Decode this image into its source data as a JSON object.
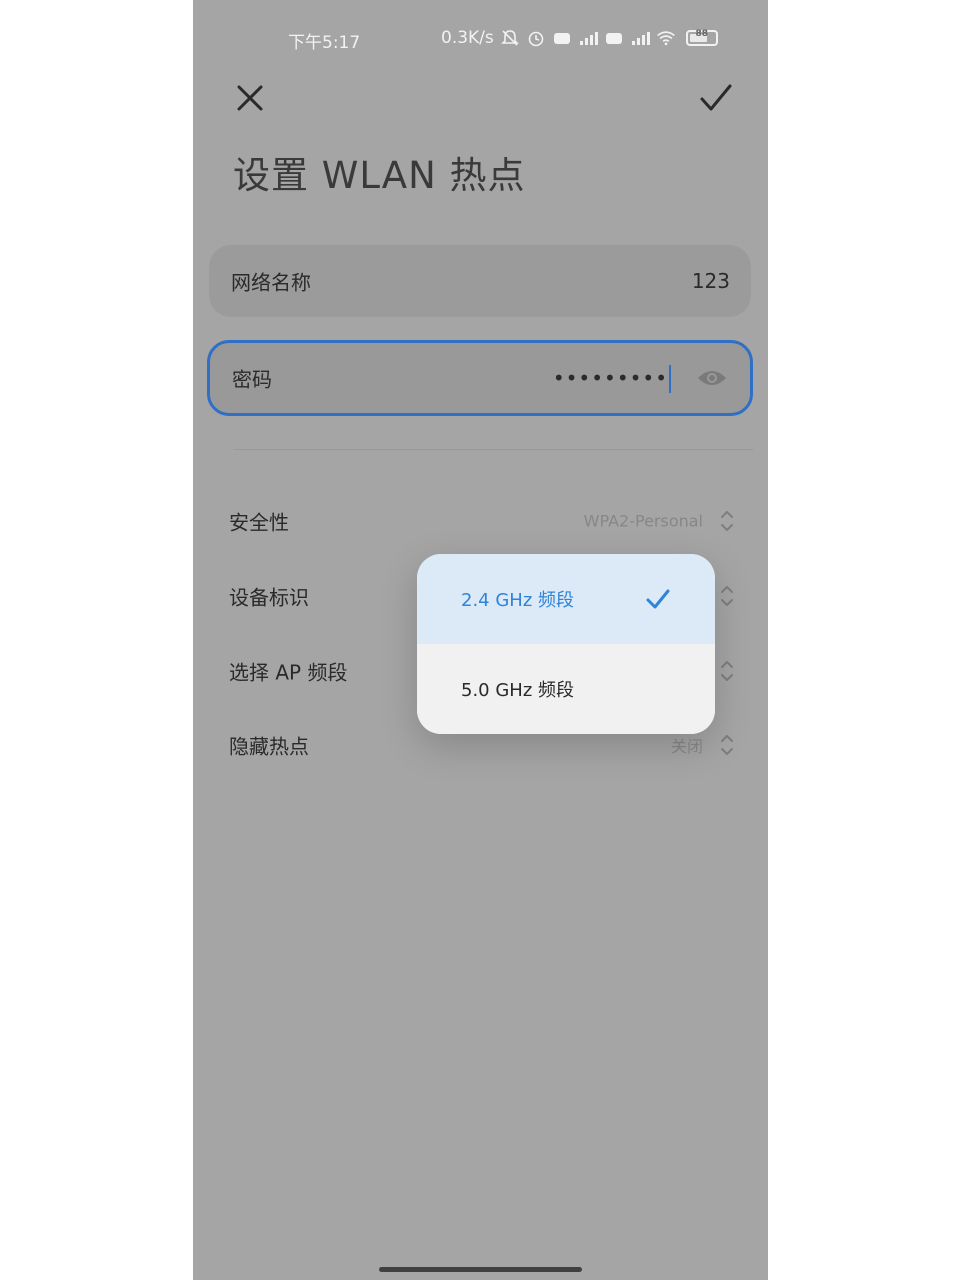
{
  "status_bar": {
    "time": "下午5:17",
    "net_speed": "0.3K/s",
    "battery_level": "88"
  },
  "header": {
    "title": "设置 WLAN 热点"
  },
  "form": {
    "ssid_label": "网络名称",
    "ssid_value": "123",
    "password_label": "密码",
    "password_masked": "•••••••••"
  },
  "settings": {
    "security_label": "安全性",
    "security_value": "WPA2-Personal",
    "device_id_label": "设备标识",
    "ap_band_label": "选择 AP 频段",
    "hidden_label": "隐藏热点",
    "hidden_value": "关闭"
  },
  "band_dropdown": {
    "options": [
      {
        "label": "2.4 GHz 频段",
        "selected": true
      },
      {
        "label": "5.0 GHz 频段",
        "selected": false
      }
    ]
  },
  "colors": {
    "accent": "#2f84d8",
    "focus_border": "#2f6fc6",
    "scrim": "#a5a5a5"
  }
}
